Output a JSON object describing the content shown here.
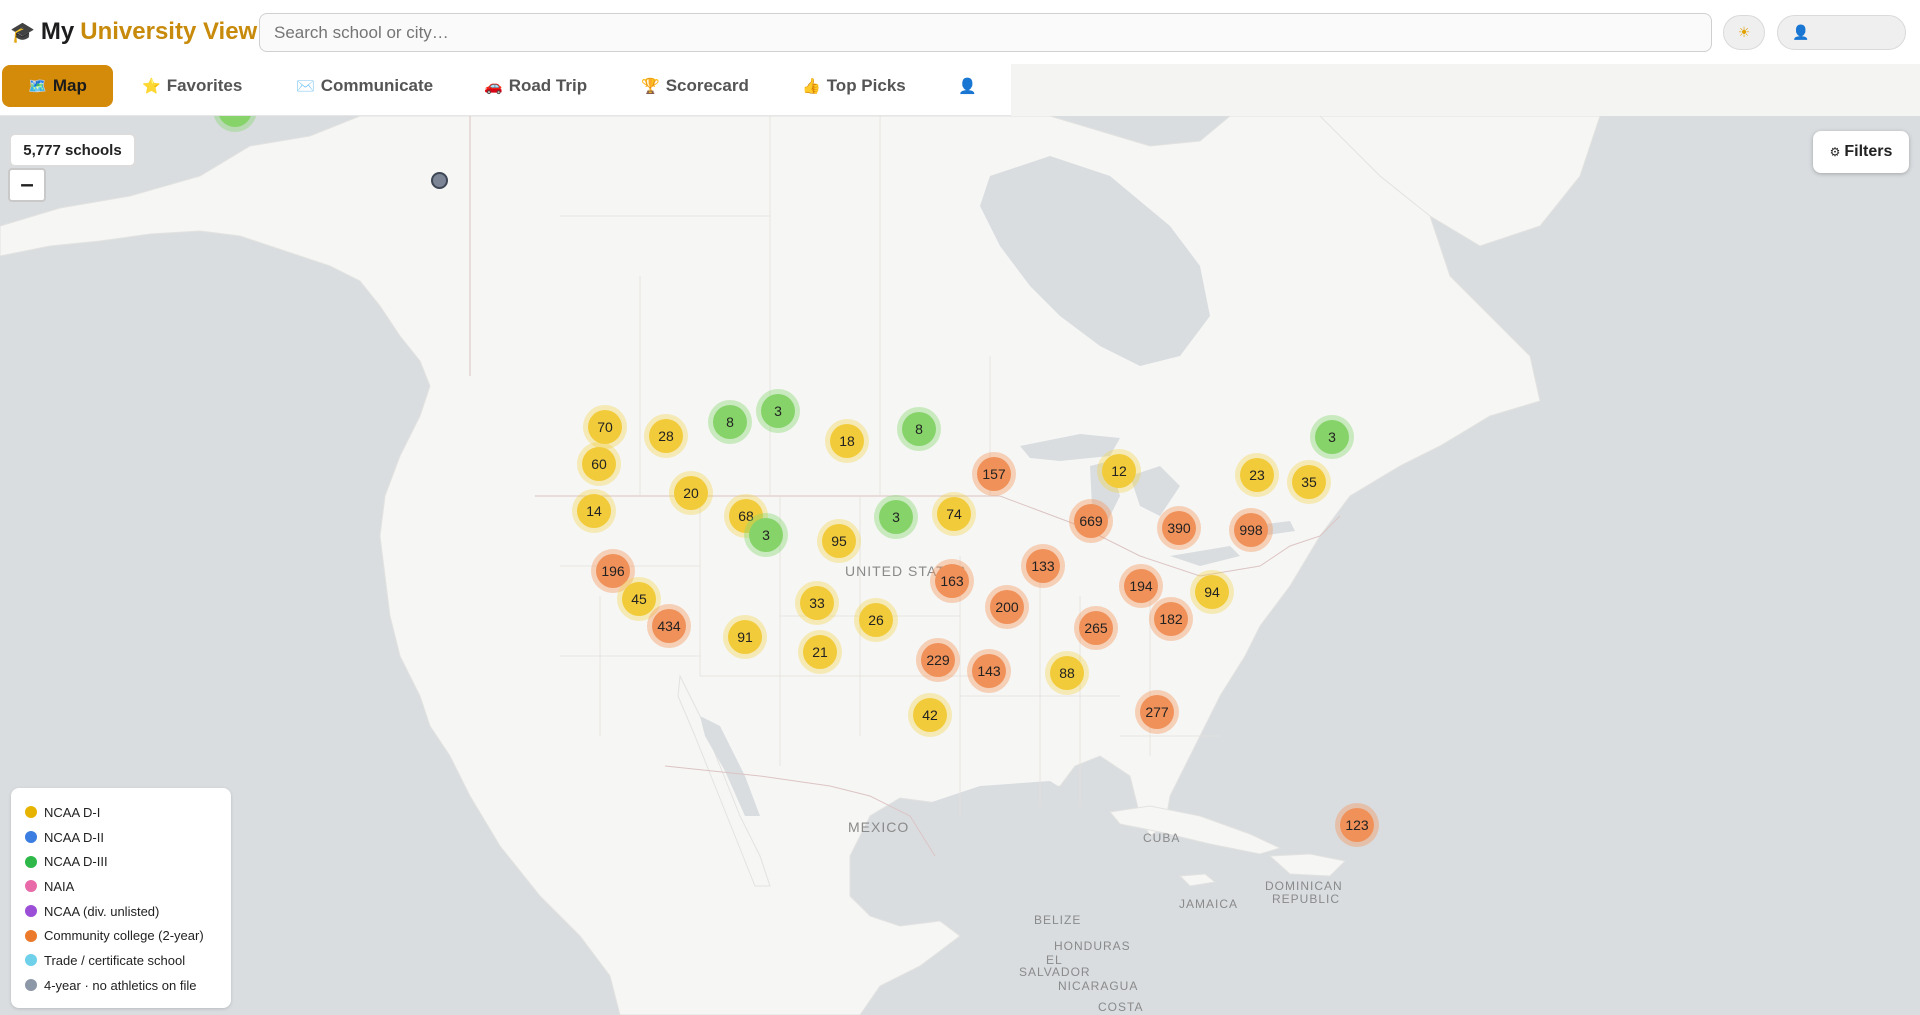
{
  "header": {
    "logo_icon": "graduation-cap-icon",
    "title_prefix": "My",
    "title_main": "University View",
    "search_placeholder": "Search school or city…",
    "theme_icon": "sun-icon",
    "user_icon": "user-icon"
  },
  "nav": {
    "tabs": [
      {
        "icon": "🗺️",
        "icon_name": "map-icon",
        "label": "Map",
        "active": true
      },
      {
        "icon": "⭐",
        "icon_name": "star-icon",
        "label": "Favorites",
        "active": false
      },
      {
        "icon": "✉️",
        "icon_name": "envelope-icon",
        "label": "Communicate",
        "active": false
      },
      {
        "icon": "🚗",
        "icon_name": "car-icon",
        "label": "Road Trip",
        "active": false
      },
      {
        "icon": "🏆",
        "icon_name": "trophy-icon",
        "label": "Scorecard",
        "active": false
      },
      {
        "icon": "👍",
        "icon_name": "thumbs-up-icon",
        "label": "Top Picks",
        "active": false
      },
      {
        "icon": "👤",
        "icon_name": "profile-icon",
        "label": "",
        "active": false
      }
    ]
  },
  "map": {
    "school_count": "5,777 schools",
    "zoom_out_label": "–",
    "filters_icon": "⚙",
    "filters_label": "Filters",
    "place_labels": [
      "UNITED STATES",
      "MEXICO",
      "CUBA",
      "JAMAICA",
      "DOMINICAN",
      "REPUBLIC",
      "BELIZE",
      "HONDURAS",
      "EL",
      "SALVADOR",
      "NICARAGUA",
      "COSTA"
    ],
    "clusters": [
      {
        "count": "70",
        "color": "yellow"
      },
      {
        "count": "28",
        "color": "yellow"
      },
      {
        "count": "8",
        "color": "green"
      },
      {
        "count": "3",
        "color": "green"
      },
      {
        "count": "18",
        "color": "yellow"
      },
      {
        "count": "8",
        "color": "green"
      },
      {
        "count": "60",
        "color": "yellow"
      },
      {
        "count": "20",
        "color": "yellow"
      },
      {
        "count": "14",
        "color": "yellow"
      },
      {
        "count": "68",
        "color": "yellow"
      },
      {
        "count": "3",
        "color": "green"
      },
      {
        "count": "95",
        "color": "yellow"
      },
      {
        "count": "3",
        "color": "green"
      },
      {
        "count": "74",
        "color": "yellow"
      },
      {
        "count": "157",
        "color": "orange"
      },
      {
        "count": "12",
        "color": "yellow"
      },
      {
        "count": "669",
        "color": "orange"
      },
      {
        "count": "390",
        "color": "orange"
      },
      {
        "count": "998",
        "color": "orange"
      },
      {
        "count": "23",
        "color": "yellow"
      },
      {
        "count": "35",
        "color": "yellow"
      },
      {
        "count": "3",
        "color": "green"
      },
      {
        "count": "196",
        "color": "orange"
      },
      {
        "count": "45",
        "color": "yellow"
      },
      {
        "count": "434",
        "color": "orange"
      },
      {
        "count": "33",
        "color": "yellow"
      },
      {
        "count": "26",
        "color": "yellow"
      },
      {
        "count": "163",
        "color": "orange"
      },
      {
        "count": "133",
        "color": "orange"
      },
      {
        "count": "200",
        "color": "orange"
      },
      {
        "count": "194",
        "color": "orange"
      },
      {
        "count": "94",
        "color": "yellow"
      },
      {
        "count": "182",
        "color": "orange"
      },
      {
        "count": "265",
        "color": "orange"
      },
      {
        "count": "91",
        "color": "yellow"
      },
      {
        "count": "21",
        "color": "yellow"
      },
      {
        "count": "229",
        "color": "orange"
      },
      {
        "count": "143",
        "color": "orange"
      },
      {
        "count": "88",
        "color": "yellow"
      },
      {
        "count": "277",
        "color": "orange"
      },
      {
        "count": "42",
        "color": "yellow"
      },
      {
        "count": "123",
        "color": "orange"
      }
    ]
  },
  "legend": {
    "items": [
      {
        "label": "NCAA D-I",
        "color": "#e6b400"
      },
      {
        "label": "NCAA D-II",
        "color": "#3b7de0"
      },
      {
        "label": "NCAA D-III",
        "color": "#2fb84a"
      },
      {
        "label": "NAIA",
        "color": "#e86aa8"
      },
      {
        "label": "NCAA (div. unlisted)",
        "color": "#9b4fd6"
      },
      {
        "label": "Community college (2-year)",
        "color": "#ec7a2c"
      },
      {
        "label": "Trade / certificate school",
        "color": "#6fd0ea"
      },
      {
        "label": "4-year · no athletics on file",
        "color": "#8c97a8"
      }
    ]
  }
}
